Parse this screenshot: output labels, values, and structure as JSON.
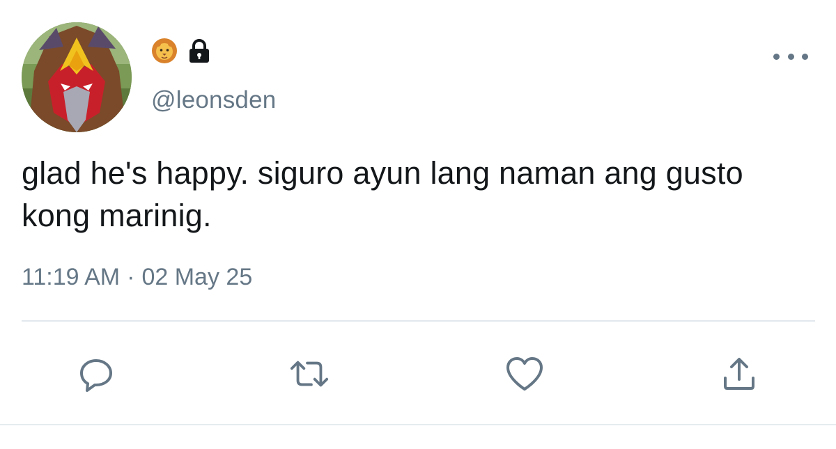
{
  "tweet": {
    "display_name_icons": [
      "lion-face-icon",
      "lock-icon"
    ],
    "handle": "@leonsden",
    "text": "glad he's happy. siguro ayun lang naman ang gusto kong marinig.",
    "time": "11:19 AM",
    "separator": "·",
    "date": "02 May 25"
  },
  "actions": [
    "reply-icon",
    "retweet-icon",
    "like-icon",
    "share-icon"
  ],
  "more_icon": "more-icon",
  "colors": {
    "text": "#14171a",
    "secondary": "#657786",
    "divider": "#e1e8ed",
    "background": "#ffffff"
  }
}
